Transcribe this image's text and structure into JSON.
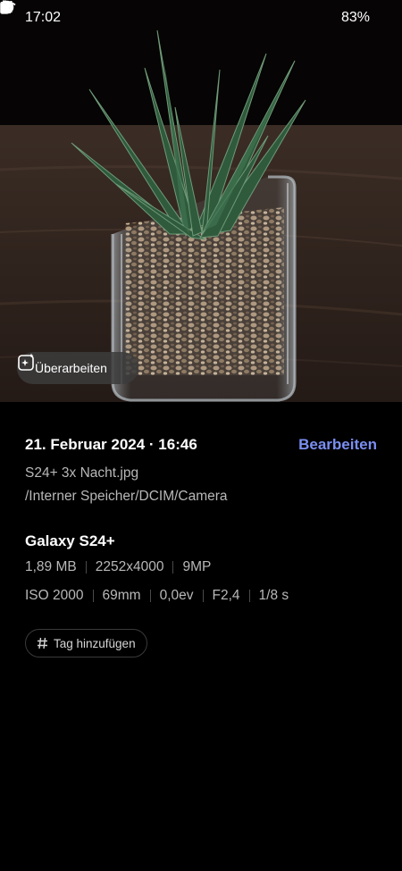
{
  "status_bar": {
    "time": "17:02",
    "left_icons": [
      "whatsapp-icon",
      "download-icon",
      "fork-icon"
    ],
    "right_icons": [
      "alarm-icon",
      "wifi-icon",
      "signal-icon",
      "battery-icon"
    ],
    "battery": "83%"
  },
  "photo": {
    "enhance_label": "Überarbeiten"
  },
  "details": {
    "datetime": "21. Februar 2024 · 16:46",
    "edit_label": "Bearbeiten",
    "file_name": "S24+ 3x Nacht.jpg",
    "file_path": "/Interner Speicher/DCIM/Camera",
    "device": "Galaxy S24+",
    "size": "1,89 MB",
    "resolution": "2252x4000",
    "megapixels": "9MP",
    "iso": "ISO 2000",
    "focal": "69mm",
    "ev": "0,0ev",
    "aperture": "F2,4",
    "shutter": "1/8 s",
    "tag_label": "Tag hinzufügen"
  },
  "colors": {
    "accent": "#7b8ff1",
    "background": "#000000",
    "secondary_text": "#b8b8b8"
  }
}
